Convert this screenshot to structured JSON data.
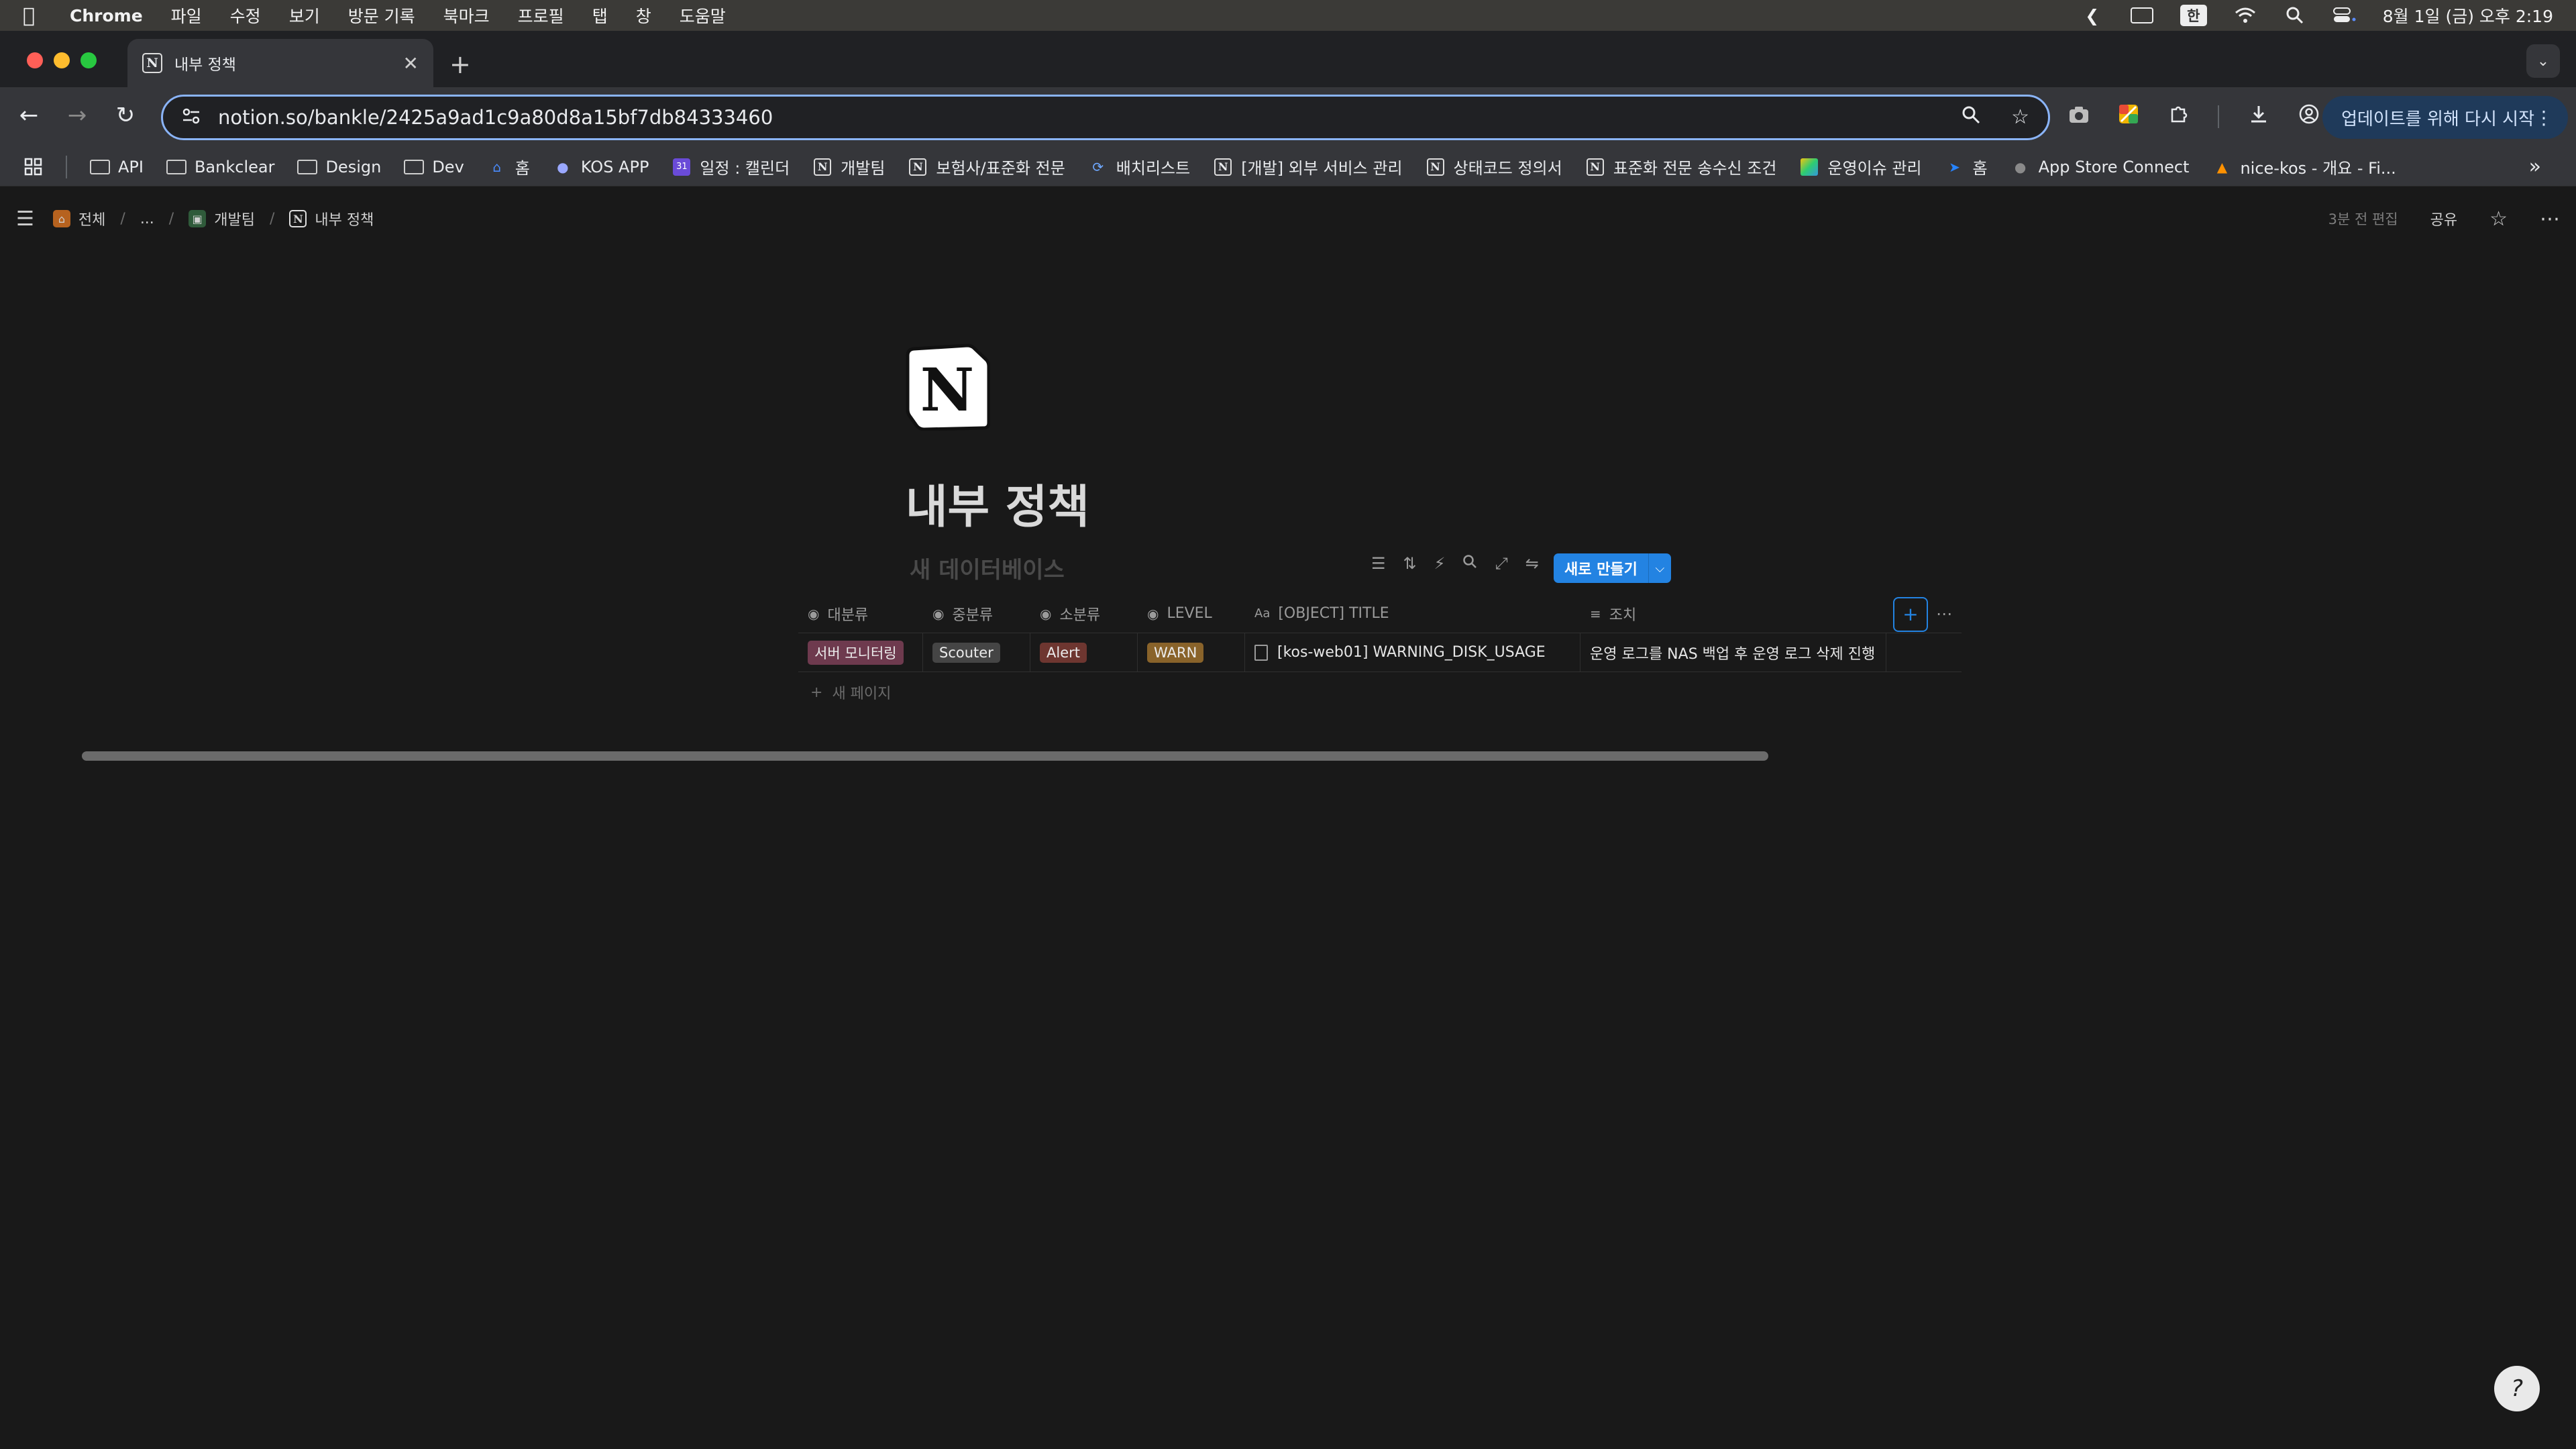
{
  "menubar": {
    "app": "Chrome",
    "items": [
      "파일",
      "수정",
      "보기",
      "방문 기록",
      "북마크",
      "프로필",
      "탭",
      "창",
      "도움말"
    ],
    "input_method": "한",
    "datetime": "8월 1일 (금) 오후 2:19"
  },
  "browser": {
    "tab_title": "내부 정책",
    "url": "notion.so/bankle/2425a9ad1c9a80d8a15bf7db84333460",
    "update_button": "업데이트를 위해 다시 시작",
    "bookmarks": [
      {
        "label": "API",
        "icon": "folder-icon"
      },
      {
        "label": "Bankclear",
        "icon": "folder-icon"
      },
      {
        "label": "Design",
        "icon": "folder-icon"
      },
      {
        "label": "Dev",
        "icon": "folder-icon"
      },
      {
        "label": "홈",
        "icon": "home-icon"
      },
      {
        "label": "KOS APP",
        "icon": "app-icon"
      },
      {
        "label": "일정 : 캘린더",
        "icon": "calendar-icon"
      },
      {
        "label": "개발팀",
        "icon": "notion-icon"
      },
      {
        "label": "보험사/표준화 전문",
        "icon": "notion-icon"
      },
      {
        "label": "배치리스트",
        "icon": "batch-icon"
      },
      {
        "label": "[개발] 외부 서비스 관리",
        "icon": "notion-icon"
      },
      {
        "label": "상태코드 정의서",
        "icon": "notion-icon"
      },
      {
        "label": "표준화 전문 송수신 조건",
        "icon": "notion-icon"
      },
      {
        "label": "운영이슈 관리",
        "icon": "image-icon"
      },
      {
        "label": "홈",
        "icon": "jira-icon"
      },
      {
        "label": "App Store Connect",
        "icon": "apple-icon"
      },
      {
        "label": "nice-kos - 개요 - Fi...",
        "icon": "firebase-icon"
      }
    ]
  },
  "notion": {
    "breadcrumbs": [
      "전체",
      "...",
      "개발팀",
      "내부 정책"
    ],
    "edited": "3분 전 편집",
    "share": "공유",
    "page_title": "내부 정책",
    "db_title": "새 데이터베이스",
    "new_button": "새로 만들기",
    "columns": [
      "대분류",
      "중분류",
      "소분류",
      "LEVEL",
      "[OBJECT] TITLE",
      "조치"
    ],
    "rows": [
      {
        "major": "서버 모니터링",
        "middle": "Scouter",
        "minor": "Alert",
        "level": "WARN",
        "title": "[kos-web01] WARNING_DISK_USAGE",
        "action": "운영 로그를 NAS 백업 후 운영 로그 삭제 진행"
      }
    ],
    "new_page": "새 페이지"
  },
  "colors": {
    "tag_major": "#6e3a4e",
    "tag_middle": "#454545",
    "tag_minor": "#6e3630",
    "tag_level": "#89632a",
    "accent": "#2383e2"
  }
}
